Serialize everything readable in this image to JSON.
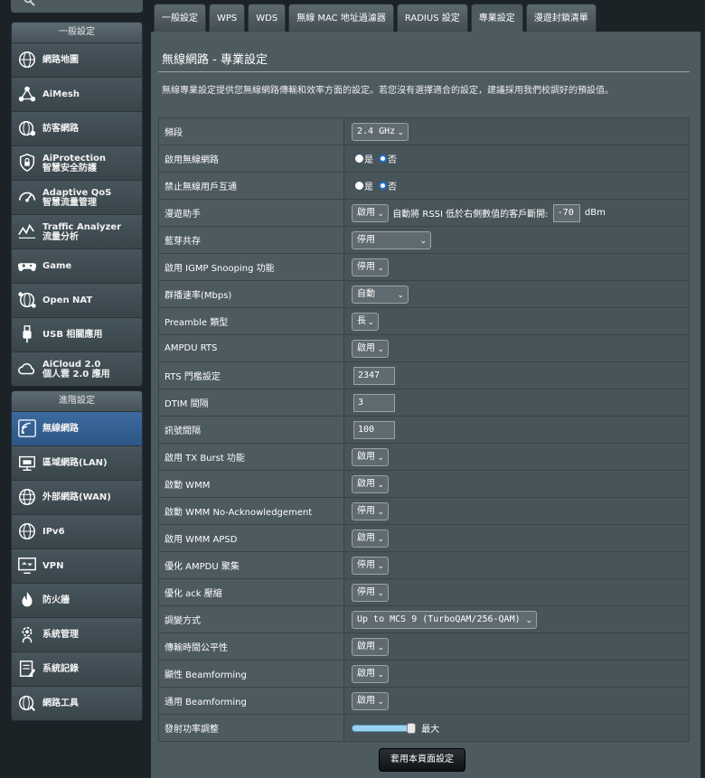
{
  "sidebar": {
    "general_header": "一般設定",
    "general_items": [
      {
        "id": "network-map",
        "label1": "網路地圖",
        "label2": "",
        "icon": "globe-icon"
      },
      {
        "id": "aimesh",
        "label1": "AiMesh",
        "label2": "",
        "icon": "aimesh-icon"
      },
      {
        "id": "guest-network",
        "label1": "訪客網路",
        "label2": "",
        "icon": "guest-globe-icon"
      },
      {
        "id": "aiprotection",
        "label1": "AiProtection",
        "label2": "智慧安全防護",
        "icon": "shield-lock-icon"
      },
      {
        "id": "adaptive-qos",
        "label1": "Adaptive QoS",
        "label2": "智慧流量管理",
        "icon": "qos-gauge-icon"
      },
      {
        "id": "traffic-analyzer",
        "label1": "Traffic Analyzer",
        "label2": "流量分析",
        "icon": "traffic-icon"
      },
      {
        "id": "game",
        "label1": "Game",
        "label2": "",
        "icon": "gamepad-icon"
      },
      {
        "id": "open-nat",
        "label1": "Open NAT",
        "label2": "",
        "icon": "nat-globe-icon"
      },
      {
        "id": "usb-app",
        "label1": "USB 相關應用",
        "label2": "",
        "icon": "usb-icon"
      },
      {
        "id": "aicloud",
        "label1": "AiCloud 2.0",
        "label2": "個人雲 2.0 應用",
        "icon": "cloud-icon"
      }
    ],
    "advanced_header": "進階設定",
    "advanced_items": [
      {
        "id": "wireless",
        "label1": "無線網路",
        "label2": "",
        "icon": "wifi-icon",
        "active": true
      },
      {
        "id": "lan",
        "label1": "區域網路(LAN)",
        "label2": "",
        "icon": "lan-icon"
      },
      {
        "id": "wan",
        "label1": "外部網路(WAN)",
        "label2": "",
        "icon": "wan-globe-icon"
      },
      {
        "id": "ipv6",
        "label1": "IPv6",
        "label2": "",
        "icon": "ipv6-globe-icon"
      },
      {
        "id": "vpn",
        "label1": "VPN",
        "label2": "",
        "icon": "vpn-monitor-icon"
      },
      {
        "id": "firewall",
        "label1": "防火牆",
        "label2": "",
        "icon": "firewall-flame-icon"
      },
      {
        "id": "administration",
        "label1": "系統管理",
        "label2": "",
        "icon": "admin-gear-icon"
      },
      {
        "id": "system-log",
        "label1": "系統記錄",
        "label2": "",
        "icon": "log-icon"
      },
      {
        "id": "network-tools",
        "label1": "網路工具",
        "label2": "",
        "icon": "tools-globe-icon"
      }
    ]
  },
  "tabs": [
    "一般設定",
    "WPS",
    "WDS",
    "無線 MAC 地址過濾器",
    "RADIUS 設定",
    "專業設定",
    "漫遊封鎖清單"
  ],
  "active_tab": 5,
  "main": {
    "title": "無線網路 - 專業設定",
    "description": "無線專業設定提供您無線網路傳輸和效率方面的設定。若您沒有選擇適合的設定，建議採用我們校調好的預設值。",
    "apply_label": "套用本頁面設定"
  },
  "fields": {
    "band": {
      "label": "頻段",
      "value": "2.4 GHz"
    },
    "enable_radio": {
      "label": "啟用無線網路",
      "yes": "是",
      "no": "否"
    },
    "ap_isolation": {
      "label": "禁止無線用戶互通",
      "yes": "是",
      "no": "否"
    },
    "roaming": {
      "label": "漫遊助手",
      "value": "啟用",
      "text": "自動將 RSSI 低於右側數值的客戶斷開:",
      "rssi": "-70",
      "unit": "dBm"
    },
    "bt_coex": {
      "label": "藍芽共存",
      "value": "停用"
    },
    "igmp": {
      "label": "啟用 IGMP Snooping 功能",
      "value": "停用"
    },
    "multicast": {
      "label": "群播速率(Mbps)",
      "value": "自動"
    },
    "preamble": {
      "label": "Preamble 類型",
      "value": "長"
    },
    "ampdu_rts": {
      "label": "AMPDU RTS",
      "value": "啟用"
    },
    "rts": {
      "label": "RTS 門檻設定",
      "value": "2347"
    },
    "dtim": {
      "label": "DTIM 間隔",
      "value": "3"
    },
    "beacon": {
      "label": "訊號間隔",
      "value": "100"
    },
    "tx_burst": {
      "label": "啟用 TX Burst 功能",
      "value": "啟用"
    },
    "wmm": {
      "label": "啟動 WMM",
      "value": "啟用"
    },
    "wmm_noack": {
      "label": "啟動 WMM No-Acknowledgement",
      "value": "停用"
    },
    "wmm_apsd": {
      "label": "啟用 WMM APSD",
      "value": "啟用"
    },
    "ampdu_agg": {
      "label": "優化 AMPDU 聚集",
      "value": "停用"
    },
    "ack_supp": {
      "label": "優化 ack 壓縮",
      "value": "停用"
    },
    "modulation": {
      "label": "調變方式",
      "value": "Up to MCS 9 (TurboQAM/256-QAM)"
    },
    "airtime": {
      "label": "傳輸時間公平性",
      "value": "啟用"
    },
    "explicit_bf": {
      "label": "顯性 Beamforming",
      "value": "啟用"
    },
    "universal_bf": {
      "label": "通用 Beamforming",
      "value": "啟用"
    },
    "tx_power": {
      "label": "發射功率調整",
      "value": "最大",
      "level_percent": 100
    }
  }
}
